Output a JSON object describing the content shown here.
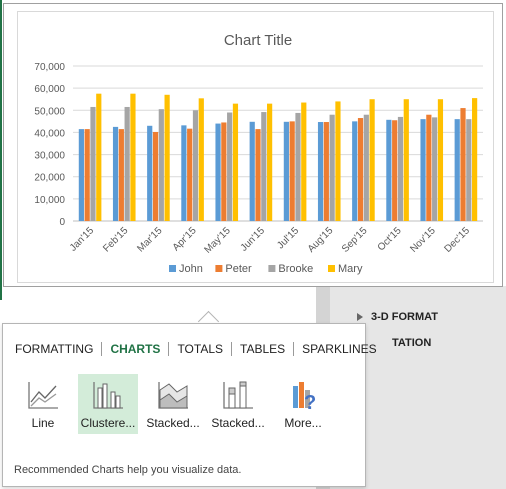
{
  "colors": {
    "john": "#5b9bd5",
    "peter": "#ed7d31",
    "brooke": "#a5a5a5",
    "mary": "#ffc000",
    "accent_green": "#217346"
  },
  "background_panel": {
    "items": [
      "3-D FORMAT",
      "TATION"
    ]
  },
  "chart_data": {
    "type": "bar",
    "title": "Chart Title",
    "categories": [
      "Jan'15",
      "Feb'15",
      "Mar'15",
      "Apr'15",
      "May'15",
      "Jun'15",
      "Jul'15",
      "Aug'15",
      "Sep'15",
      "Oct'15",
      "Nov'15",
      "Dec'15"
    ],
    "series": [
      {
        "name": "John",
        "values": [
          41500,
          42500,
          43000,
          43200,
          44000,
          44800,
          44800,
          44700,
          45000,
          45700,
          46000,
          46000
        ]
      },
      {
        "name": "Peter",
        "values": [
          41500,
          41500,
          40200,
          41700,
          44500,
          41500,
          45000,
          44700,
          46500,
          45500,
          48000,
          51000
        ]
      },
      {
        "name": "Brooke",
        "values": [
          51500,
          51500,
          50500,
          50000,
          49000,
          49200,
          48800,
          48000,
          48000,
          47000,
          46800,
          46000
        ]
      },
      {
        "name": "Mary",
        "values": [
          57500,
          57500,
          57000,
          55400,
          53000,
          53000,
          53500,
          54000,
          55000,
          55000,
          55000,
          55500
        ]
      }
    ],
    "ylim": [
      0,
      70000
    ],
    "yticks": [
      "0",
      "10,000",
      "20,000",
      "30,000",
      "40,000",
      "50,000",
      "60,000",
      "70,000"
    ],
    "grid": true,
    "legend": "bottom"
  },
  "popup": {
    "tabs": [
      "FORMATTING",
      "CHARTS",
      "TOTALS",
      "TABLES",
      "SPARKLINES"
    ],
    "active_tab": "CHARTS",
    "options": [
      {
        "label": "Line",
        "icon": "line-chart-icon"
      },
      {
        "label": "Clustere...",
        "icon": "clustered-column-icon"
      },
      {
        "label": "Stacked...",
        "icon": "stacked-area-icon"
      },
      {
        "label": "Stacked...",
        "icon": "stacked-column-icon"
      },
      {
        "label": "More...",
        "icon": "more-charts-icon"
      }
    ],
    "hint": "Recommended Charts help you visualize data."
  }
}
